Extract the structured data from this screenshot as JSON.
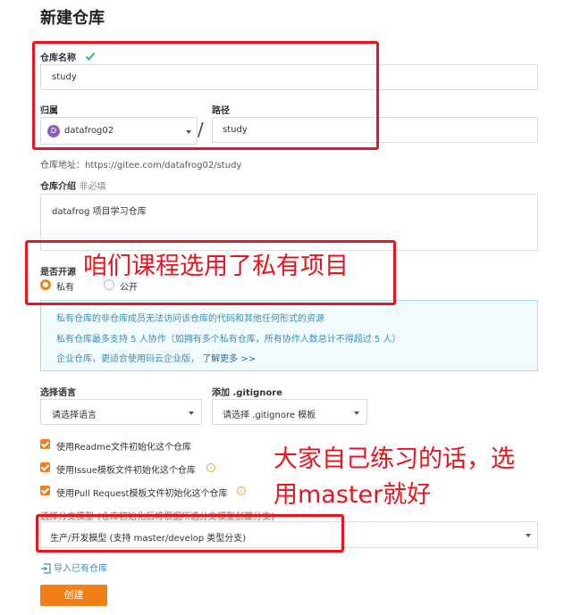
{
  "page": {
    "title": "新建仓库"
  },
  "repo_name": {
    "label": "仓库名称",
    "check_icon": "check-icon",
    "value": "study"
  },
  "owner": {
    "label": "归属",
    "avatar_letter": "D",
    "value": "datafrog02"
  },
  "separator": "/",
  "path": {
    "label": "路径",
    "value": "study"
  },
  "repo_address": {
    "label": "仓库地址：",
    "url": "https://gitee.com/datafrog02/study"
  },
  "intro": {
    "label": "仓库介绍",
    "hint": "非必填",
    "value": "datafrog 项目学习仓库"
  },
  "open_source": {
    "label": "是否开源",
    "options": [
      {
        "label": "私有",
        "selected": true
      },
      {
        "label": "公开",
        "selected": false
      }
    ]
  },
  "notes": {
    "line1": "私有仓库的非仓库成员无法访问该仓库的代码和其他任何形式的资源",
    "line2": "私有仓库最多支持 5 人协作（如拥有多个私有仓库，所有协作人数总计不得超过 5 人）",
    "line3": "企业仓库，更适合使用码云企业版，",
    "link": "了解更多 >>"
  },
  "language": {
    "label": "选择语言",
    "value": "请选择语言"
  },
  "gitignore": {
    "label": "添加 .gitignore",
    "value": "请选择 .gitignore 模板"
  },
  "checkboxes": [
    {
      "label": "使用Readme文件初始化这个仓库",
      "checked": true
    },
    {
      "label": "使用Issue模板文件初始化这个仓库",
      "checked": true
    },
    {
      "label": "使用Pull Request模板文件初始化这个仓库",
      "checked": true
    }
  ],
  "branch_model": {
    "label": "选择分支模型 (仓库初始化后将根据所选分支模型创建分支)",
    "value": "生产/开发模型 (支持 master/develop 类型分支)"
  },
  "import_link": "导入已有仓库",
  "create_button": "创建",
  "annotations": {
    "private_note": "咱们课程选用了私有项目",
    "master_note_line1": "大家自己练习的话，选",
    "master_note_line2": "用master就好"
  },
  "colors": {
    "accent": "#f07f1a",
    "annotation": "#e8141e",
    "info_bg": "#f1fafd",
    "info_border": "#a6dcec",
    "info_text": "#3a8fb7",
    "link": "#3a8fb7"
  }
}
